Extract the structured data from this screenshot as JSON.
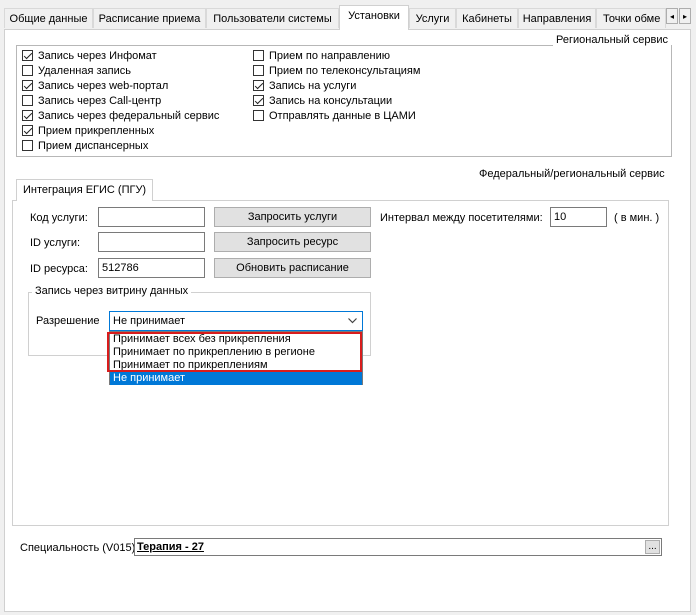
{
  "tabs": [
    {
      "label": "Общие данные"
    },
    {
      "label": "Расписание приема"
    },
    {
      "label": "Пользователи системы"
    },
    {
      "label": "Установки"
    },
    {
      "label": "Услуги"
    },
    {
      "label": "Кабинеты"
    },
    {
      "label": "Направления"
    },
    {
      "label": "Точки обме"
    }
  ],
  "tab_scroll": {
    "left_icon": "arrow-left-icon",
    "right_icon": "arrow-right-icon",
    "left_glyph": "◂",
    "right_glyph": "▸"
  },
  "regional": {
    "title": "Региональный сервис",
    "left": [
      {
        "label": "Запись через Инфомат",
        "checked": true
      },
      {
        "label": "Удаленная запись",
        "checked": false
      },
      {
        "label": "Запись через web-портал",
        "checked": true
      },
      {
        "label": "Запись через Call-центр",
        "checked": false
      },
      {
        "label": "Запись через федеральный сервис",
        "checked": true
      },
      {
        "label": "Прием прикрепленных",
        "checked": true
      },
      {
        "label": "Прием диспансерных",
        "checked": false
      }
    ],
    "right": [
      {
        "label": "Прием по направлению",
        "checked": false
      },
      {
        "label": "Прием по телеконсультациям",
        "checked": false
      },
      {
        "label": "Запись на услуги",
        "checked": true
      },
      {
        "label": "Запись на консультации",
        "checked": true
      },
      {
        "label": "Отправлять данные в ЦАМИ",
        "checked": false
      }
    ]
  },
  "federal": {
    "title": "Федеральный/региональный сервис",
    "inner_tab": "Интеграция ЕГИС (ПГУ)",
    "service_code_label": "Код услуги:",
    "service_code_value": "",
    "service_id_label": "ID услуги:",
    "service_id_value": "",
    "resource_id_label": "ID ресурса:",
    "resource_id_value": "512786",
    "btn_request_services": "Запросить услуги",
    "btn_request_resource": "Запросить ресурс",
    "btn_update_schedule": "Обновить расписание",
    "interval_label": "Интервал между посетителями:",
    "interval_value": "10",
    "interval_unit": "( в мин. )",
    "showcase": {
      "title": "Запись через витрину данных",
      "permission_label": "Разрешение",
      "permission_value": "Не принимает",
      "options": [
        "Принимает всех без прикрепления",
        "Принимает по прикреплению в регионе",
        "Принимает по прикреплениям",
        "Не принимает"
      ],
      "selected_index": 3
    }
  },
  "specialty": {
    "label": "Специальность (V015)",
    "value": "Терапия - 27",
    "dots": "..."
  },
  "colors": {
    "selection": "#0078d7",
    "highlight": "#d91c1c"
  }
}
